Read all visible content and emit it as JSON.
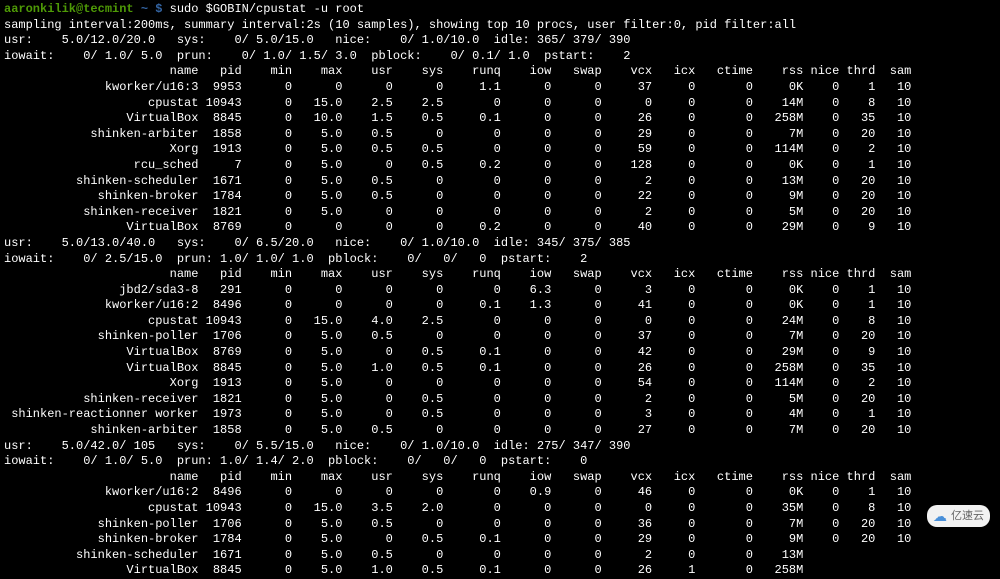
{
  "prompt": {
    "user": "aaronkilik@tecmint",
    "sep": " ~ $ ",
    "cmd": "sudo $GOBIN/cpustat -u root"
  },
  "line_sampling": "sampling interval:200ms, summary interval:2s (10 samples), showing top 10 procs, user filter:0, pid filter:all",
  "col_widths": {
    "name": 27,
    "pid": 6,
    "min": 7,
    "max": 7,
    "usr": 7,
    "sys": 7,
    "runq": 8,
    "iow": 7,
    "swap": 7,
    "vcx": 7,
    "icx": 6,
    "ctime": 8,
    "rss": 7,
    "nice": 5,
    "thrd": 5,
    "sam": 5
  },
  "header_cols": [
    "name",
    "pid",
    "min",
    "max",
    "usr",
    "sys",
    "runq",
    "iow",
    "swap",
    "vcx",
    "icx",
    "ctime",
    "rss",
    "nice",
    "thrd",
    "sam"
  ],
  "blocks": [
    {
      "summary": [
        "usr:    5.0/12.0/20.0   sys:    0/ 5.0/15.0   nice:    0/ 1.0/10.0  idle: 365/ 379/ 390",
        "iowait:    0/ 1.0/ 5.0  prun:    0/ 1.0/ 1.5/ 3.0  pblock:    0/ 0.1/ 1.0  pstart:    2"
      ],
      "rows": [
        {
          "name": "kworker/u16:3",
          "pid": "9953",
          "min": "0",
          "max": "0",
          "usr": "0",
          "sys": "0",
          "runq": "1.1",
          "iow": "0",
          "swap": "0",
          "vcx": "37",
          "icx": "0",
          "ctime": "0",
          "rss": "0K",
          "nice": "0",
          "thrd": "1",
          "sam": "10"
        },
        {
          "name": "cpustat",
          "pid": "10943",
          "min": "0",
          "max": "15.0",
          "usr": "2.5",
          "sys": "2.5",
          "runq": "0",
          "iow": "0",
          "swap": "0",
          "vcx": "0",
          "icx": "0",
          "ctime": "0",
          "rss": "14M",
          "nice": "0",
          "thrd": "8",
          "sam": "10"
        },
        {
          "name": "VirtualBox",
          "pid": "8845",
          "min": "0",
          "max": "10.0",
          "usr": "1.5",
          "sys": "0.5",
          "runq": "0.1",
          "iow": "0",
          "swap": "0",
          "vcx": "26",
          "icx": "0",
          "ctime": "0",
          "rss": "258M",
          "nice": "0",
          "thrd": "35",
          "sam": "10"
        },
        {
          "name": "shinken-arbiter",
          "pid": "1858",
          "min": "0",
          "max": "5.0",
          "usr": "0.5",
          "sys": "0",
          "runq": "0",
          "iow": "0",
          "swap": "0",
          "vcx": "29",
          "icx": "0",
          "ctime": "0",
          "rss": "7M",
          "nice": "0",
          "thrd": "20",
          "sam": "10"
        },
        {
          "name": "Xorg",
          "pid": "1913",
          "min": "0",
          "max": "5.0",
          "usr": "0.5",
          "sys": "0.5",
          "runq": "0",
          "iow": "0",
          "swap": "0",
          "vcx": "59",
          "icx": "0",
          "ctime": "0",
          "rss": "114M",
          "nice": "0",
          "thrd": "2",
          "sam": "10"
        },
        {
          "name": "rcu_sched",
          "pid": "7",
          "min": "0",
          "max": "5.0",
          "usr": "0",
          "sys": "0.5",
          "runq": "0.2",
          "iow": "0",
          "swap": "0",
          "vcx": "128",
          "icx": "0",
          "ctime": "0",
          "rss": "0K",
          "nice": "0",
          "thrd": "1",
          "sam": "10"
        },
        {
          "name": "shinken-scheduler",
          "pid": "1671",
          "min": "0",
          "max": "5.0",
          "usr": "0.5",
          "sys": "0",
          "runq": "0",
          "iow": "0",
          "swap": "0",
          "vcx": "2",
          "icx": "0",
          "ctime": "0",
          "rss": "13M",
          "nice": "0",
          "thrd": "20",
          "sam": "10"
        },
        {
          "name": "shinken-broker",
          "pid": "1784",
          "min": "0",
          "max": "5.0",
          "usr": "0.5",
          "sys": "0",
          "runq": "0",
          "iow": "0",
          "swap": "0",
          "vcx": "22",
          "icx": "0",
          "ctime": "0",
          "rss": "9M",
          "nice": "0",
          "thrd": "20",
          "sam": "10"
        },
        {
          "name": "shinken-receiver",
          "pid": "1821",
          "min": "0",
          "max": "5.0",
          "usr": "0",
          "sys": "0",
          "runq": "0",
          "iow": "0",
          "swap": "0",
          "vcx": "2",
          "icx": "0",
          "ctime": "0",
          "rss": "5M",
          "nice": "0",
          "thrd": "20",
          "sam": "10"
        },
        {
          "name": "VirtualBox",
          "pid": "8769",
          "min": "0",
          "max": "0",
          "usr": "0",
          "sys": "0",
          "runq": "0.2",
          "iow": "0",
          "swap": "0",
          "vcx": "40",
          "icx": "0",
          "ctime": "0",
          "rss": "29M",
          "nice": "0",
          "thrd": "9",
          "sam": "10"
        }
      ]
    },
    {
      "summary": [
        "usr:    5.0/13.0/40.0   sys:    0/ 6.5/20.0   nice:    0/ 1.0/10.0  idle: 345/ 375/ 385",
        "iowait:    0/ 2.5/15.0  prun: 1.0/ 1.0/ 1.0  pblock:    0/   0/   0  pstart:    2"
      ],
      "rows": [
        {
          "name": "jbd2/sda3-8",
          "pid": "291",
          "min": "0",
          "max": "0",
          "usr": "0",
          "sys": "0",
          "runq": "0",
          "iow": "6.3",
          "swap": "0",
          "vcx": "3",
          "icx": "0",
          "ctime": "0",
          "rss": "0K",
          "nice": "0",
          "thrd": "1",
          "sam": "10"
        },
        {
          "name": "kworker/u16:2",
          "pid": "8496",
          "min": "0",
          "max": "0",
          "usr": "0",
          "sys": "0",
          "runq": "0.1",
          "iow": "1.3",
          "swap": "0",
          "vcx": "41",
          "icx": "0",
          "ctime": "0",
          "rss": "0K",
          "nice": "0",
          "thrd": "1",
          "sam": "10"
        },
        {
          "name": "cpustat",
          "pid": "10943",
          "min": "0",
          "max": "15.0",
          "usr": "4.0",
          "sys": "2.5",
          "runq": "0",
          "iow": "0",
          "swap": "0",
          "vcx": "0",
          "icx": "0",
          "ctime": "0",
          "rss": "24M",
          "nice": "0",
          "thrd": "8",
          "sam": "10"
        },
        {
          "name": "shinken-poller",
          "pid": "1706",
          "min": "0",
          "max": "5.0",
          "usr": "0.5",
          "sys": "0",
          "runq": "0",
          "iow": "0",
          "swap": "0",
          "vcx": "37",
          "icx": "0",
          "ctime": "0",
          "rss": "7M",
          "nice": "0",
          "thrd": "20",
          "sam": "10"
        },
        {
          "name": "VirtualBox",
          "pid": "8769",
          "min": "0",
          "max": "5.0",
          "usr": "0",
          "sys": "0.5",
          "runq": "0.1",
          "iow": "0",
          "swap": "0",
          "vcx": "42",
          "icx": "0",
          "ctime": "0",
          "rss": "29M",
          "nice": "0",
          "thrd": "9",
          "sam": "10"
        },
        {
          "name": "VirtualBox",
          "pid": "8845",
          "min": "0",
          "max": "5.0",
          "usr": "1.0",
          "sys": "0.5",
          "runq": "0.1",
          "iow": "0",
          "swap": "0",
          "vcx": "26",
          "icx": "0",
          "ctime": "0",
          "rss": "258M",
          "nice": "0",
          "thrd": "35",
          "sam": "10"
        },
        {
          "name": "Xorg",
          "pid": "1913",
          "min": "0",
          "max": "5.0",
          "usr": "0",
          "sys": "0",
          "runq": "0",
          "iow": "0",
          "swap": "0",
          "vcx": "54",
          "icx": "0",
          "ctime": "0",
          "rss": "114M",
          "nice": "0",
          "thrd": "2",
          "sam": "10"
        },
        {
          "name": "shinken-receiver",
          "pid": "1821",
          "min": "0",
          "max": "5.0",
          "usr": "0",
          "sys": "0.5",
          "runq": "0",
          "iow": "0",
          "swap": "0",
          "vcx": "2",
          "icx": "0",
          "ctime": "0",
          "rss": "5M",
          "nice": "0",
          "thrd": "20",
          "sam": "10"
        },
        {
          "name": "shinken-reactionner worker",
          "pid": "1973",
          "min": "0",
          "max": "5.0",
          "usr": "0",
          "sys": "0.5",
          "runq": "0",
          "iow": "0",
          "swap": "0",
          "vcx": "3",
          "icx": "0",
          "ctime": "0",
          "rss": "4M",
          "nice": "0",
          "thrd": "1",
          "sam": "10"
        },
        {
          "name": "shinken-arbiter",
          "pid": "1858",
          "min": "0",
          "max": "5.0",
          "usr": "0.5",
          "sys": "0",
          "runq": "0",
          "iow": "0",
          "swap": "0",
          "vcx": "27",
          "icx": "0",
          "ctime": "0",
          "rss": "7M",
          "nice": "0",
          "thrd": "20",
          "sam": "10"
        }
      ]
    },
    {
      "summary": [
        "usr:    5.0/42.0/ 105   sys:    0/ 5.5/15.0   nice:    0/ 1.0/10.0  idle: 275/ 347/ 390",
        "iowait:    0/ 1.0/ 5.0  prun: 1.0/ 1.4/ 2.0  pblock:    0/   0/   0  pstart:    0"
      ],
      "rows": [
        {
          "name": "kworker/u16:2",
          "pid": "8496",
          "min": "0",
          "max": "0",
          "usr": "0",
          "sys": "0",
          "runq": "0",
          "iow": "0.9",
          "swap": "0",
          "vcx": "46",
          "icx": "0",
          "ctime": "0",
          "rss": "0K",
          "nice": "0",
          "thrd": "1",
          "sam": "10"
        },
        {
          "name": "cpustat",
          "pid": "10943",
          "min": "0",
          "max": "15.0",
          "usr": "3.5",
          "sys": "2.0",
          "runq": "0",
          "iow": "0",
          "swap": "0",
          "vcx": "0",
          "icx": "0",
          "ctime": "0",
          "rss": "35M",
          "nice": "0",
          "thrd": "8",
          "sam": "10"
        },
        {
          "name": "shinken-poller",
          "pid": "1706",
          "min": "0",
          "max": "5.0",
          "usr": "0.5",
          "sys": "0",
          "runq": "0",
          "iow": "0",
          "swap": "0",
          "vcx": "36",
          "icx": "0",
          "ctime": "0",
          "rss": "7M",
          "nice": "0",
          "thrd": "20",
          "sam": "10"
        },
        {
          "name": "shinken-broker",
          "pid": "1784",
          "min": "0",
          "max": "5.0",
          "usr": "0",
          "sys": "0.5",
          "runq": "0.1",
          "iow": "0",
          "swap": "0",
          "vcx": "29",
          "icx": "0",
          "ctime": "0",
          "rss": "9M",
          "nice": "0",
          "thrd": "20",
          "sam": "10"
        },
        {
          "name": "shinken-scheduler",
          "pid": "1671",
          "min": "0",
          "max": "5.0",
          "usr": "0.5",
          "sys": "0",
          "runq": "0",
          "iow": "0",
          "swap": "0",
          "vcx": "2",
          "icx": "0",
          "ctime": "0",
          "rss": "13M",
          "nice": "",
          "thrd": "",
          "sam": ""
        },
        {
          "name": "VirtualBox",
          "pid": "8845",
          "min": "0",
          "max": "5.0",
          "usr": "1.0",
          "sys": "0.5",
          "runq": "0.1",
          "iow": "0",
          "swap": "0",
          "vcx": "26",
          "icx": "1",
          "ctime": "0",
          "rss": "258M",
          "nice": "",
          "thrd": "",
          "sam": ""
        }
      ]
    }
  ],
  "watermark": "亿速云"
}
